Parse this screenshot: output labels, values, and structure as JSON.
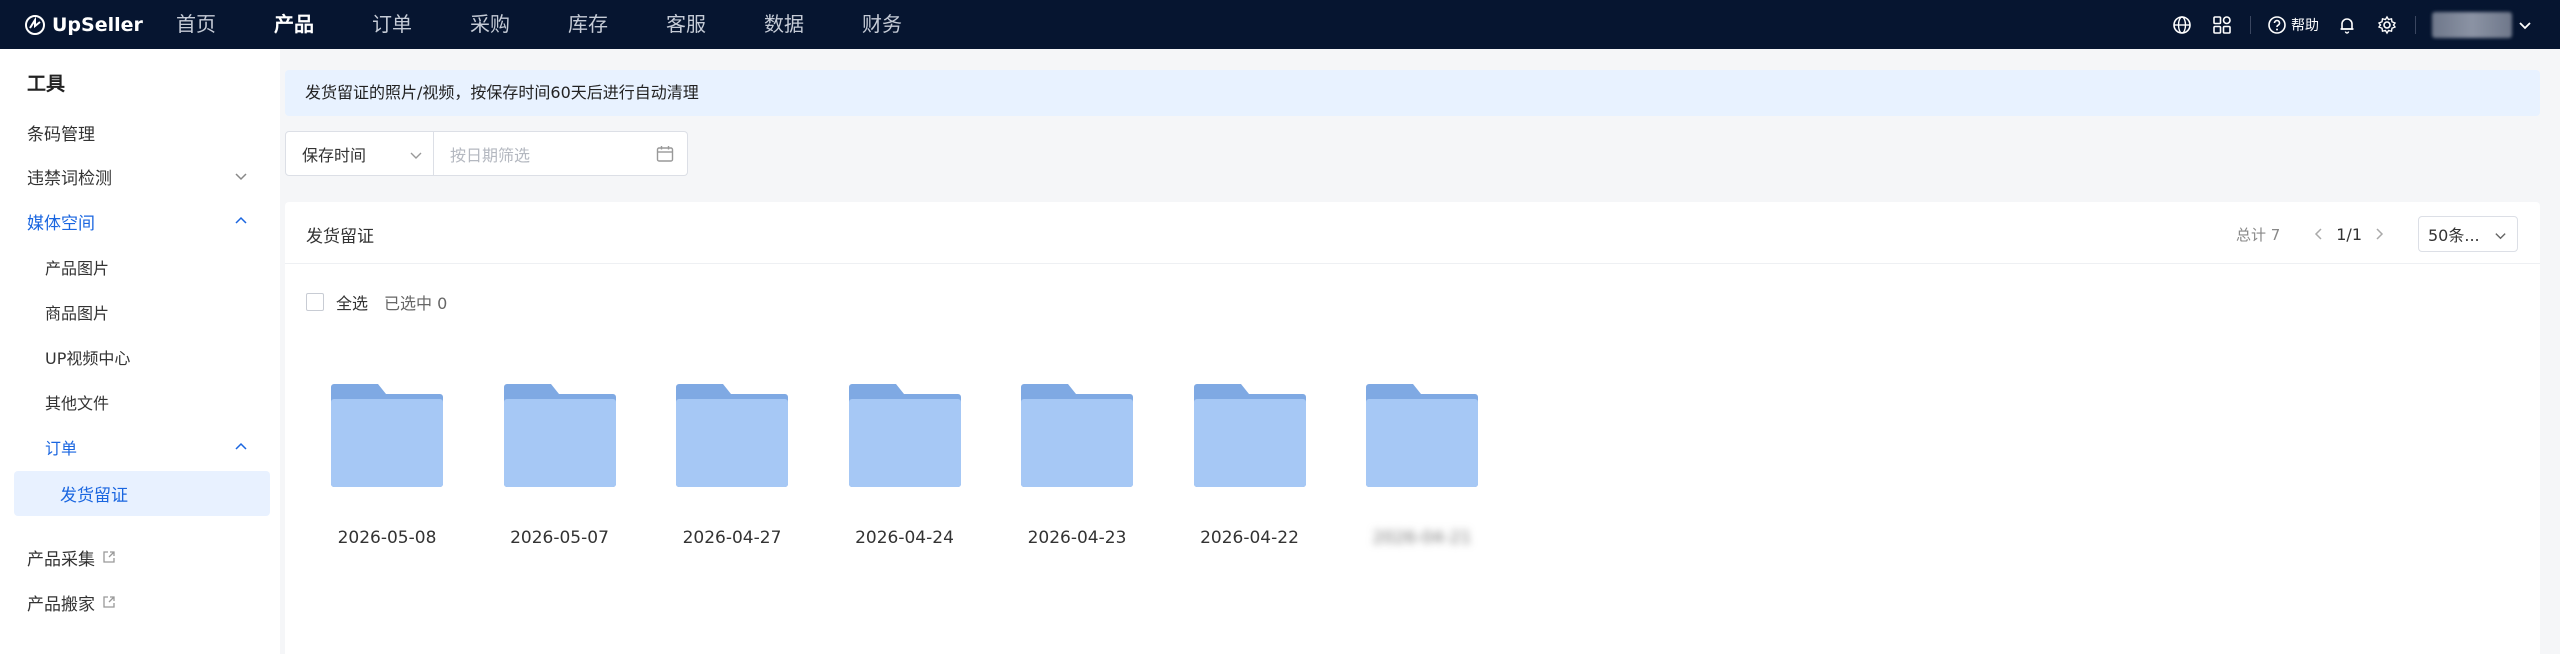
{
  "brand": {
    "name": "UpSeller"
  },
  "nav": [
    {
      "label": "首页",
      "active": false
    },
    {
      "label": "产品",
      "active": true
    },
    {
      "label": "订单",
      "active": false
    },
    {
      "label": "采购",
      "active": false
    },
    {
      "label": "库存",
      "active": false
    },
    {
      "label": "客服",
      "active": false
    },
    {
      "label": "数据",
      "active": false
    },
    {
      "label": "财务",
      "active": false
    }
  ],
  "topbar": {
    "help_label": "帮助"
  },
  "sidebar": {
    "title": "工具",
    "items": [
      {
        "label": "条码管理"
      },
      {
        "label": "违禁词检测"
      },
      {
        "label": "媒体空间"
      },
      {
        "label": "产品图片"
      },
      {
        "label": "商品图片"
      },
      {
        "label": "UP视频中心"
      },
      {
        "label": "其他文件"
      },
      {
        "label": "订单"
      },
      {
        "label": "发货留证"
      },
      {
        "label": "产品采集"
      },
      {
        "label": "产品搬家"
      }
    ]
  },
  "notice": {
    "text": "发货留证的照片/视频，按保存时间60天后进行自动清理"
  },
  "filter": {
    "select_value": "保存时间",
    "date_placeholder": "按日期筛选"
  },
  "panel": {
    "title": "发货留证",
    "total_label": "总计 7",
    "page_label": "1/1",
    "per_page": "50条..."
  },
  "selection": {
    "select_all": "全选",
    "selected_count": "已选中 0"
  },
  "folders": [
    {
      "name": "2026-05-08"
    },
    {
      "name": "2026-05-07"
    },
    {
      "name": "2026-04-27"
    },
    {
      "name": "2026-04-24"
    },
    {
      "name": "2026-04-23"
    },
    {
      "name": "2026-04-22"
    },
    {
      "name": "2026-04-21"
    }
  ],
  "colors": {
    "topbar": "#061530",
    "accent": "#1a66e0",
    "folder": "#a6c8f5",
    "folder_tab": "#7fa9e3"
  }
}
